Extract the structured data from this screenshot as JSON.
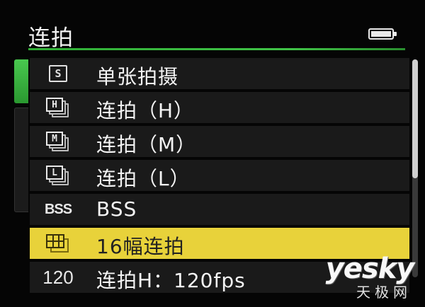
{
  "header": {
    "title": "连拍"
  },
  "menu": {
    "items": [
      {
        "icon": "single-frame-icon",
        "icon_text": "S",
        "label": "单张拍摄",
        "selected": false
      },
      {
        "icon": "continuous-high-icon",
        "icon_text": "H",
        "label": "连拍（H）",
        "selected": false
      },
      {
        "icon": "continuous-medium-icon",
        "icon_text": "M",
        "label": "连拍（M）",
        "selected": false
      },
      {
        "icon": "continuous-low-icon",
        "icon_text": "L",
        "label": "连拍（L）",
        "selected": false
      },
      {
        "icon": "bss-icon",
        "icon_text": "BSS",
        "label": "BSS",
        "selected": false
      },
      {
        "icon": "multi-shot-16-icon",
        "icon_text": "",
        "label": "16幅连拍",
        "selected": true
      },
      {
        "icon": "fps-120-icon",
        "icon_text": "120",
        "label": "连拍H：120fps",
        "selected": false
      }
    ]
  },
  "watermark": {
    "main": "yesky",
    "sub": "天极网"
  },
  "colors": {
    "accent_green": "#41c448",
    "selected_bg": "#e8d23a",
    "row_bg": "#1a1a1a"
  }
}
